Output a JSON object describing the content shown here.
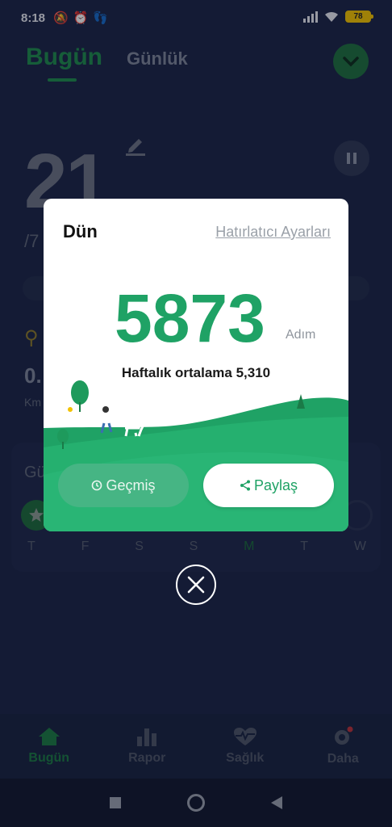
{
  "status": {
    "time": "8:18",
    "left_icons": [
      "bell-off-icon",
      "alarm-icon",
      "footsteps-icon"
    ],
    "battery": "78"
  },
  "tabs": {
    "today": "Bugün",
    "daily": "Günlük"
  },
  "background": {
    "steps": "21",
    "goal": "/7",
    "distance": "0.",
    "distance_unit": "Km",
    "week_title": "Gü",
    "weekdays": [
      "T",
      "F",
      "S",
      "S",
      "M",
      "T",
      "W"
    ]
  },
  "dialog": {
    "title": "Dün",
    "reminder_link": "Hatırlatıcı Ayarları",
    "steps": "5873",
    "steps_unit": "Adım",
    "weekly_average": "Haftalık ortalama 5,310",
    "history_label": "Geçmiş",
    "share_label": "Paylaş"
  },
  "nav": {
    "items": [
      {
        "label": "Bugün",
        "icon": "home-icon"
      },
      {
        "label": "Rapor",
        "icon": "bar-chart-icon"
      },
      {
        "label": "Sağlık",
        "icon": "heart-pulse-icon"
      },
      {
        "label": "Daha",
        "icon": "gear-icon"
      }
    ]
  },
  "colors": {
    "accent": "#1fa265",
    "background": "#1c2646",
    "dialog": "#ffffff"
  }
}
